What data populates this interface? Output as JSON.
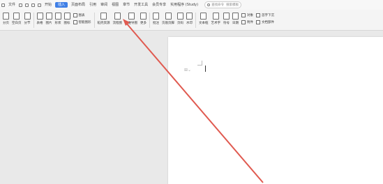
{
  "menubar": {
    "file": "文件",
    "menus": [
      "开始",
      "插入",
      "页面布局",
      "引用",
      "审阅",
      "视图",
      "章节",
      "开发工具",
      "会员专享",
      "实用程序 (Study)"
    ],
    "active_menu": "插入",
    "search_label": "查找命令",
    "search_extra": "搜索模板"
  },
  "ribbon": {
    "tools": [
      "分页",
      "空白页",
      "分节",
      "表格",
      "图片",
      "形状",
      "图标"
    ],
    "stack1": [
      "图表",
      "智能图形"
    ],
    "tools2": [
      "稻壳资源",
      "流程图",
      "思维导图",
      "更多"
    ],
    "tools3": [
      "批注",
      "页眉页脚",
      "页码",
      "水印"
    ],
    "tools4": [
      "文本框",
      "艺术字",
      "符号",
      "日期",
      "对象",
      "附件",
      "文档部件"
    ],
    "stack2": [
      "首字下沉",
      "超链接"
    ]
  },
  "colors": {
    "accent": "#3f7fe6",
    "arrow": "#e05a50"
  }
}
